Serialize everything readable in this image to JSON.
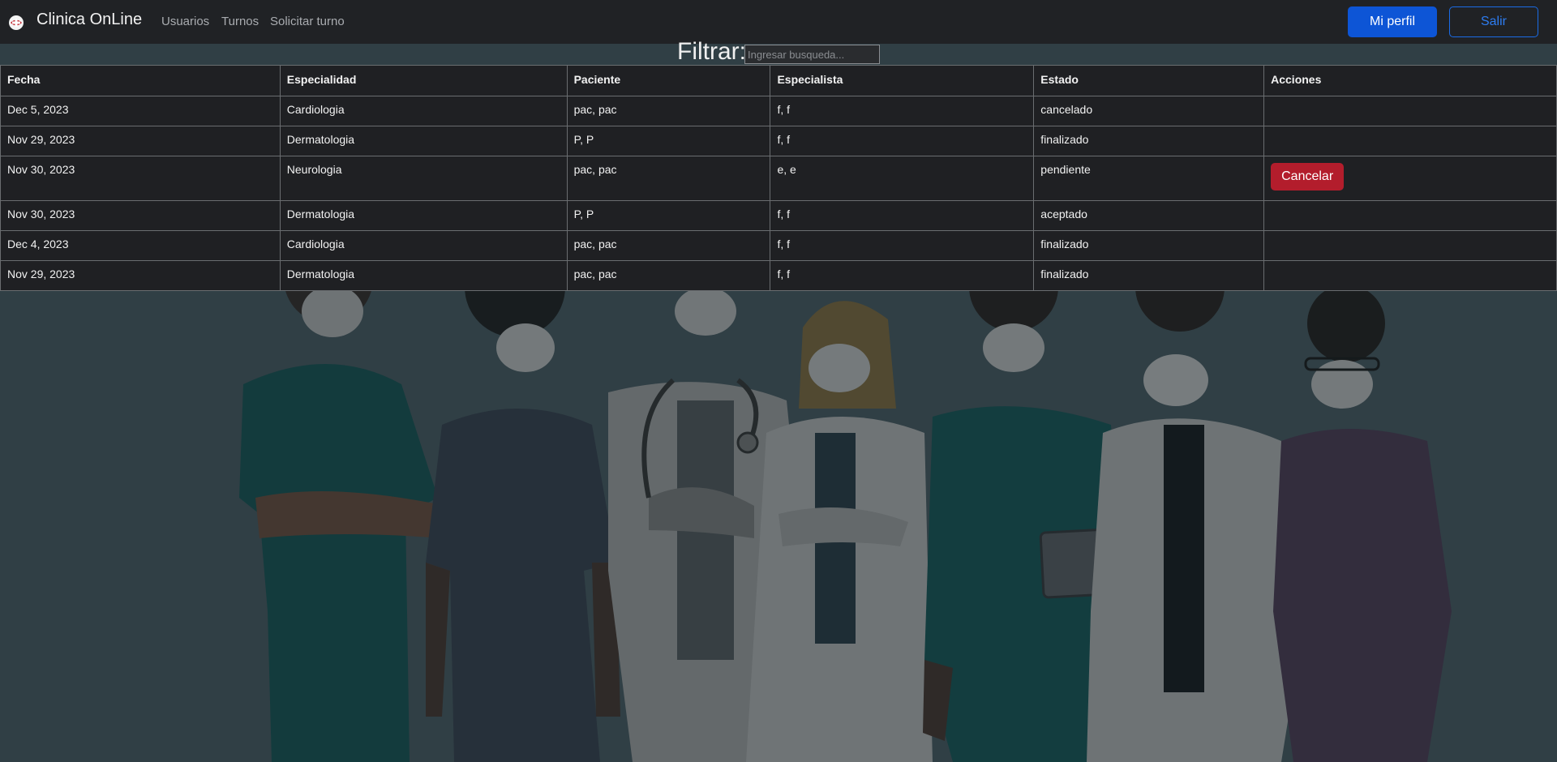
{
  "navbar": {
    "brand": "Clinica OnLine",
    "links": [
      "Usuarios",
      "Turnos",
      "Solicitar turno"
    ],
    "profile_button": "Mi perfil",
    "logout_button": "Salir"
  },
  "filter": {
    "label": "Filtrar:",
    "placeholder": "Ingresar busqueda...",
    "value": ""
  },
  "table": {
    "headers": [
      "Fecha",
      "Especialidad",
      "Paciente",
      "Especialista",
      "Estado",
      "Acciones"
    ],
    "rows": [
      {
        "fecha": "Dec 5, 2023",
        "especialidad": "Cardiologia",
        "paciente": "pac, pac",
        "especialista": "f, f",
        "estado": "cancelado",
        "accion": ""
      },
      {
        "fecha": "Nov 29, 2023",
        "especialidad": "Dermatologia",
        "paciente": "P, P",
        "especialista": "f, f",
        "estado": "finalizado",
        "accion": ""
      },
      {
        "fecha": "Nov 30, 2023",
        "especialidad": "Neurologia",
        "paciente": "pac, pac",
        "especialista": "e, e",
        "estado": "pendiente",
        "accion": "Cancelar"
      },
      {
        "fecha": "Nov 30, 2023",
        "especialidad": "Dermatologia",
        "paciente": "P, P",
        "especialista": "f, f",
        "estado": "aceptado",
        "accion": ""
      },
      {
        "fecha": "Dec 4, 2023",
        "especialidad": "Cardiologia",
        "paciente": "pac, pac",
        "especialista": "f, f",
        "estado": "finalizado",
        "accion": ""
      },
      {
        "fecha": "Nov 29, 2023",
        "especialidad": "Dermatologia",
        "paciente": "pac, pac",
        "especialista": "f, f",
        "estado": "finalizado",
        "accion": ""
      }
    ]
  },
  "colors": {
    "navbar_bg": "#202225",
    "primary": "#0d55d6",
    "danger": "#b31d2c",
    "page_bg": "#3a4a50"
  }
}
